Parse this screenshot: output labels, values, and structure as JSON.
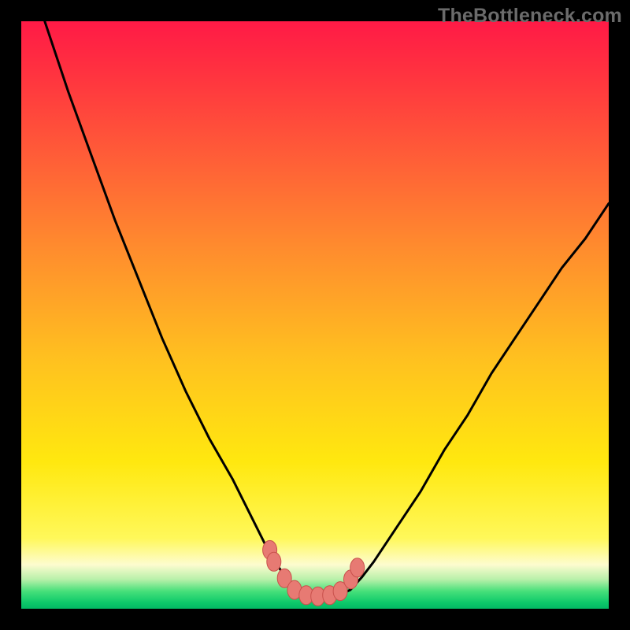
{
  "watermark": "TheBottleneck.com",
  "colors": {
    "frame": "#000000",
    "curve_stroke": "#000000",
    "marker_fill": "#e77a73",
    "marker_stroke": "#c9514c",
    "gradient_stops": [
      "#ff1a46",
      "#ff3040",
      "#ff5a38",
      "#ff8a2e",
      "#ffc21f",
      "#ffe80f",
      "#fff85a",
      "#fdfccf",
      "#b8f0aa",
      "#48e07a",
      "#0cc96a",
      "#03b864"
    ]
  },
  "chart_data": {
    "type": "line",
    "title": "",
    "xlabel": "",
    "ylabel": "",
    "xlim": [
      0,
      100
    ],
    "ylim": [
      0,
      100
    ],
    "x": [
      4,
      8,
      12,
      16,
      20,
      24,
      28,
      32,
      36,
      39,
      42,
      44.5,
      46,
      48,
      50,
      52,
      54,
      56,
      58,
      60,
      64,
      68,
      72,
      76,
      80,
      84,
      88,
      92,
      96,
      100
    ],
    "y": [
      100,
      88,
      77,
      66,
      56,
      46,
      37,
      29,
      22,
      16,
      10,
      6,
      3.6,
      2.3,
      2.0,
      2.0,
      2.3,
      3.2,
      5.4,
      8.0,
      14,
      20,
      27,
      33,
      40,
      46,
      52,
      58,
      63,
      69
    ],
    "markers": {
      "x": [
        42.3,
        43.0,
        44.8,
        46.5,
        48.5,
        50.5,
        52.5,
        54.3,
        56.1,
        57.2
      ],
      "y": [
        10.0,
        8.0,
        5.2,
        3.2,
        2.3,
        2.1,
        2.3,
        3.0,
        5.0,
        7.0
      ]
    },
    "notes": "Single V-shaped curve. y-axis inverted visually (0 at bottom = green, 100 at top = red). Markers cluster at trough."
  }
}
